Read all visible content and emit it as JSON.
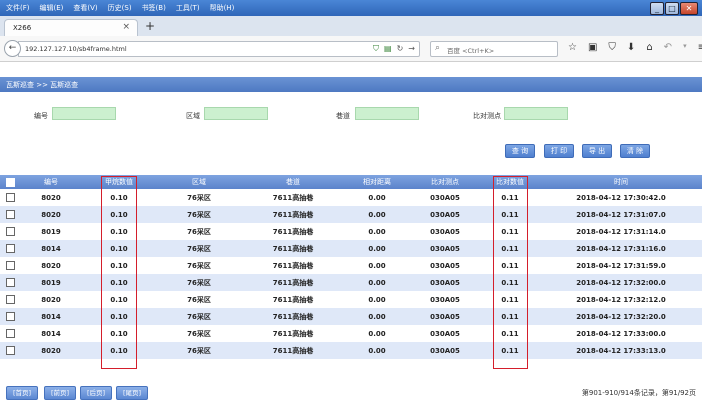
{
  "browser": {
    "menu": [
      "文件(F)",
      "编辑(E)",
      "查看(V)",
      "历史(S)",
      "书签(B)",
      "工具(T)",
      "帮助(H)"
    ],
    "window_buttons": [
      "_",
      "□",
      "✕"
    ],
    "tab_title": "X266",
    "tab_close": "×",
    "new_tab": "+",
    "url": "192.127.127.10/sb4frame.html",
    "search_placeholder": "百度 <Ctrl+K>"
  },
  "breadcrumb": "瓦斯巡查 >> 瓦斯巡查",
  "filters": {
    "number_label": "编号",
    "area_label": "区域",
    "roadway_label": "巷道",
    "compare_point_label": "比对测点"
  },
  "buttons": {
    "query": "查 询",
    "print": "打 印",
    "export": "导 出",
    "clear": "清 除"
  },
  "table": {
    "columns": [
      "编号",
      "甲烷数值",
      "区域",
      "巷道",
      "相对距离",
      "比对测点",
      "比对数值",
      "时间"
    ],
    "rows": [
      [
        "8020",
        "0.10",
        "76采区",
        "7611高抽巷",
        "0.00",
        "030A05",
        "0.11",
        "2018-04-12 17:30:42.0"
      ],
      [
        "8020",
        "0.10",
        "76采区",
        "7611高抽巷",
        "0.00",
        "030A05",
        "0.11",
        "2018-04-12 17:31:07.0"
      ],
      [
        "8019",
        "0.10",
        "76采区",
        "7611高抽巷",
        "0.00",
        "030A05",
        "0.11",
        "2018-04-12 17:31:14.0"
      ],
      [
        "8014",
        "0.10",
        "76采区",
        "7611高抽巷",
        "0.00",
        "030A05",
        "0.11",
        "2018-04-12 17:31:16.0"
      ],
      [
        "8020",
        "0.10",
        "76采区",
        "7611高抽巷",
        "0.00",
        "030A05",
        "0.11",
        "2018-04-12 17:31:59.0"
      ],
      [
        "8019",
        "0.10",
        "76采区",
        "7611高抽巷",
        "0.00",
        "030A05",
        "0.11",
        "2018-04-12 17:32:00.0"
      ],
      [
        "8020",
        "0.10",
        "76采区",
        "7611高抽巷",
        "0.00",
        "030A05",
        "0.11",
        "2018-04-12 17:32:12.0"
      ],
      [
        "8014",
        "0.10",
        "76采区",
        "7611高抽巷",
        "0.00",
        "030A05",
        "0.11",
        "2018-04-12 17:32:20.0"
      ],
      [
        "8014",
        "0.10",
        "76采区",
        "7611高抽巷",
        "0.00",
        "030A05",
        "0.11",
        "2018-04-12 17:33:00.0"
      ],
      [
        "8020",
        "0.10",
        "76采区",
        "7611高抽巷",
        "0.00",
        "030A05",
        "0.11",
        "2018-04-12 17:33:13.0"
      ]
    ]
  },
  "pager": {
    "first": "[首页]",
    "prev": "[前页]",
    "next": "[后页]",
    "last": "[尾页]",
    "info": "第901-910/914条记录，第91/92页"
  },
  "colors": {
    "header_blue": "#5b83cb",
    "row_alt": "#dfe8f8",
    "filter_green": "#ccf0cf",
    "highlight_red": "#d41e2b"
  }
}
